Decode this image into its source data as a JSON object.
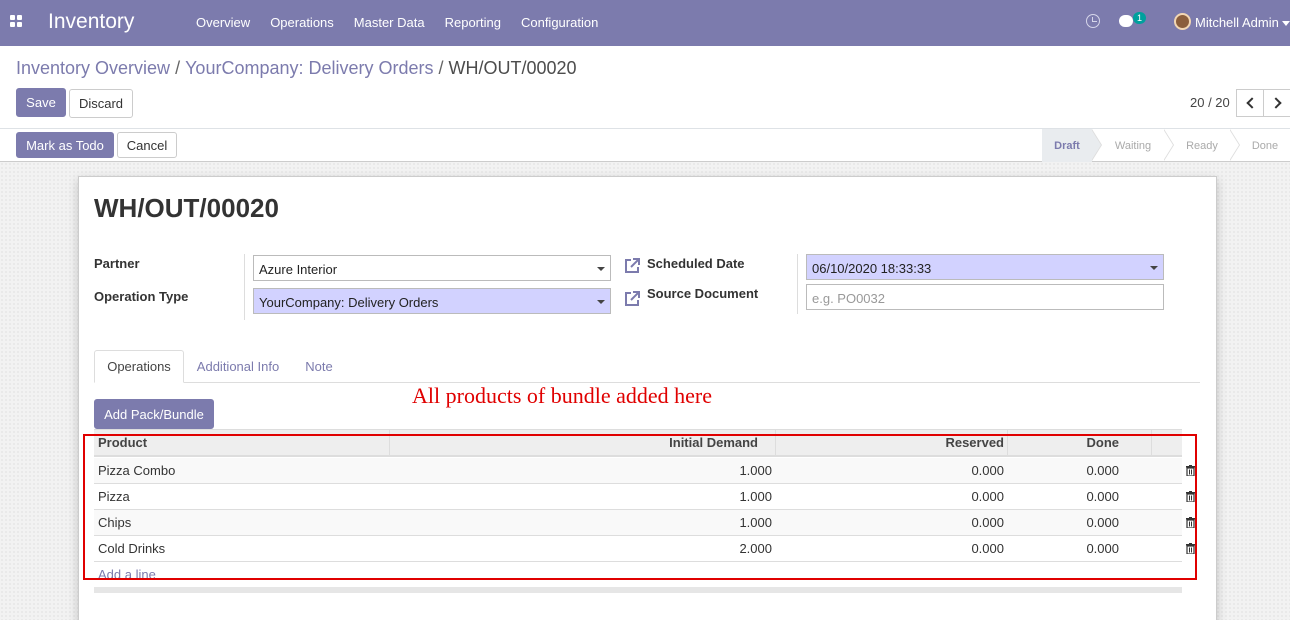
{
  "navbar": {
    "app_title": "Inventory",
    "menu": [
      "Overview",
      "Operations",
      "Master Data",
      "Reporting",
      "Configuration"
    ],
    "chat_count": "1",
    "user_name": "Mitchell Admin",
    "icons": [
      "apps-icon",
      "clock-icon",
      "chat-icon",
      "avatar"
    ]
  },
  "breadcrumb": {
    "items": [
      "Inventory Overview",
      "YourCompany: Delivery Orders"
    ],
    "current": "WH/OUT/00020",
    "separator": "/"
  },
  "toolbar": {
    "save_label": "Save",
    "discard_label": "Discard"
  },
  "pager": {
    "value": "20 / 20"
  },
  "actions": {
    "mark_todo_label": "Mark as Todo",
    "cancel_label": "Cancel"
  },
  "statusbar": {
    "stages": [
      "Draft",
      "Waiting",
      "Ready",
      "Done"
    ],
    "active": "Draft"
  },
  "form": {
    "title": "WH/OUT/00020",
    "partner_label": "Partner",
    "partner_value": "Azure Interior",
    "operation_type_label": "Operation Type",
    "operation_type_value": "YourCompany: Delivery Orders",
    "scheduled_date_label": "Scheduled Date",
    "scheduled_date_value": "06/10/2020 18:33:33",
    "source_document_label": "Source Document",
    "source_document_placeholder": "e.g. PO0032"
  },
  "tabs": [
    "Operations",
    "Additional Info",
    "Note"
  ],
  "active_tab": "Operations",
  "annotation": "All products of bundle added here",
  "add_pack_label": "Add Pack/Bundle",
  "table": {
    "columns": [
      "Product",
      "Initial Demand",
      "Reserved",
      "Done"
    ],
    "rows": [
      [
        "Pizza Combo",
        "1.000",
        "0.000",
        "0.000"
      ],
      [
        "Pizza",
        "1.000",
        "0.000",
        "0.000"
      ],
      [
        "Chips",
        "1.000",
        "0.000",
        "0.000"
      ],
      [
        "Cold Drinks",
        "2.000",
        "0.000",
        "0.000"
      ]
    ],
    "add_line_label": "Add a line"
  },
  "colors": {
    "brand": "#7c7bad",
    "required_field": "#d2d2ff",
    "annotation": "#e00000"
  }
}
